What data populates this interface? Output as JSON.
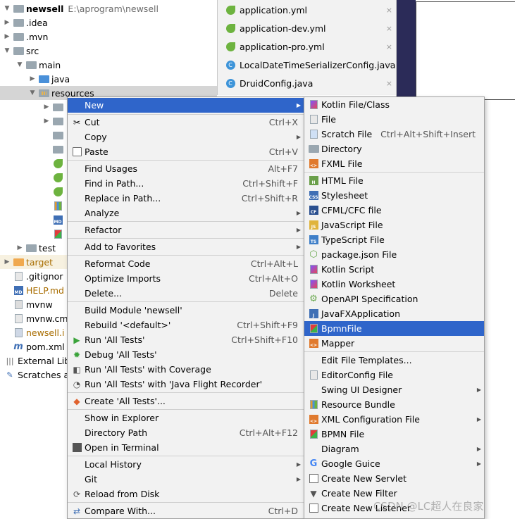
{
  "tree": {
    "rows": [
      {
        "label": "newsell",
        "path": "E:\\aprogram\\newsell",
        "icon": "project-folder-icon",
        "arrow": "▼"
      },
      {
        "label": ".idea",
        "icon": "folder-icon",
        "arrow": "▶"
      },
      {
        "label": ".mvn",
        "icon": "folder-icon",
        "arrow": "▶"
      },
      {
        "label": "src",
        "icon": "folder-icon",
        "arrow": "▼"
      },
      {
        "label": "main",
        "icon": "folder-icon",
        "arrow": "▼"
      },
      {
        "label": "java",
        "icon": "source-folder-icon",
        "arrow": "▶"
      },
      {
        "label": "resources",
        "icon": "resources-folder-icon",
        "arrow": "▼"
      },
      {
        "label": "test",
        "icon": "folder-icon",
        "arrow": "▶"
      },
      {
        "label": "target",
        "icon": "excluded-folder-icon",
        "arrow": "▶"
      },
      {
        "label": ".gitignor",
        "icon": "file-icon"
      },
      {
        "label": "HELP.md",
        "icon": "markdown-file-icon"
      },
      {
        "label": "mvnw",
        "icon": "script-file-icon"
      },
      {
        "label": "mvnw.cm",
        "icon": "file-icon"
      },
      {
        "label": "newsell.i",
        "icon": "module-file-icon"
      },
      {
        "label": "pom.xml",
        "icon": "maven-icon"
      },
      {
        "label": "External Lib",
        "icon": "library-icon"
      },
      {
        "label": "Scratches ar",
        "icon": "scratches-icon"
      }
    ]
  },
  "tabs": [
    {
      "label": "application.yml",
      "icon": "spring-leaf-icon"
    },
    {
      "label": "application-dev.yml",
      "icon": "spring-leaf-icon"
    },
    {
      "label": "application-pro.yml",
      "icon": "spring-leaf-icon"
    },
    {
      "label": "LocalDateTimeSerializerConfig.java",
      "icon": "java-class-icon"
    },
    {
      "label": "DruidConfig.java",
      "icon": "java-class-icon"
    }
  ],
  "tab_close_glyph": "×",
  "context_menu": {
    "new": "New",
    "cut": "Cut",
    "cut_sc": "Ctrl+X",
    "copy": "Copy",
    "paste": "Paste",
    "paste_sc": "Ctrl+V",
    "find_usages": "Find Usages",
    "find_usages_sc": "Alt+F7",
    "find_in_path": "Find in Path...",
    "find_in_path_sc": "Ctrl+Shift+F",
    "replace_in_path": "Replace in Path...",
    "replace_in_path_sc": "Ctrl+Shift+R",
    "analyze": "Analyze",
    "refactor": "Refactor",
    "add_to_favorites": "Add to Favorites",
    "reformat_code": "Reformat Code",
    "reformat_code_sc": "Ctrl+Alt+L",
    "optimize_imports": "Optimize Imports",
    "optimize_imports_sc": "Ctrl+Alt+O",
    "delete": "Delete...",
    "delete_sc": "Delete",
    "build_module": "Build Module 'newsell'",
    "rebuild": "Rebuild '<default>'",
    "rebuild_sc": "Ctrl+Shift+F9",
    "run_all_tests": "Run 'All Tests'",
    "run_all_tests_sc": "Ctrl+Shift+F10",
    "debug_all_tests": "Debug 'All Tests'",
    "run_with_coverage": "Run 'All Tests' with Coverage",
    "run_with_jfr": "Run 'All Tests' with 'Java Flight Recorder'",
    "create_all_tests": "Create 'All Tests'...",
    "show_in_explorer": "Show in Explorer",
    "directory_path": "Directory Path",
    "directory_path_sc": "Ctrl+Alt+F12",
    "open_in_terminal": "Open in Terminal",
    "local_history": "Local History",
    "git": "Git",
    "reload_from_disk": "Reload from Disk",
    "compare_with": "Compare With...",
    "compare_with_sc": "Ctrl+D"
  },
  "new_submenu": {
    "kotlin_file_class": "Kotlin File/Class",
    "file": "File",
    "scratch_file": "Scratch File",
    "scratch_file_sc": "Ctrl+Alt+Shift+Insert",
    "directory": "Directory",
    "fxml_file": "FXML File",
    "html_file": "HTML File",
    "stylesheet": "Stylesheet",
    "cfml_cfc_file": "CFML/CFC file",
    "javascript_file": "JavaScript File",
    "typescript_file": "TypeScript File",
    "package_json_file": "package.json File",
    "kotlin_script": "Kotlin Script",
    "kotlin_worksheet": "Kotlin Worksheet",
    "openapi_spec": "OpenAPI Specification",
    "javafx_application": "JavaFXApplication",
    "bpmn_file": "BpmnFile",
    "mapper": "Mapper",
    "edit_file_templates": "Edit File Templates...",
    "editorconfig_file": "EditorConfig File",
    "swing_ui_designer": "Swing UI Designer",
    "resource_bundle": "Resource Bundle",
    "xml_configuration_file": "XML Configuration File",
    "bpmn_file_2": "BPMN File",
    "diagram": "Diagram",
    "google_guice": "Google Guice",
    "create_new_servlet": "Create New Servlet",
    "create_new_filter": "Create New Filter",
    "create_new_listener": "Create New Listener"
  },
  "submenu_arrow": "▶",
  "watermark": "CSDN @LC超人在良家",
  "colors": {
    "highlight": "#2f65ca",
    "menu_bg": "#f2f2f2",
    "selected_row": "#d5d5d5"
  }
}
